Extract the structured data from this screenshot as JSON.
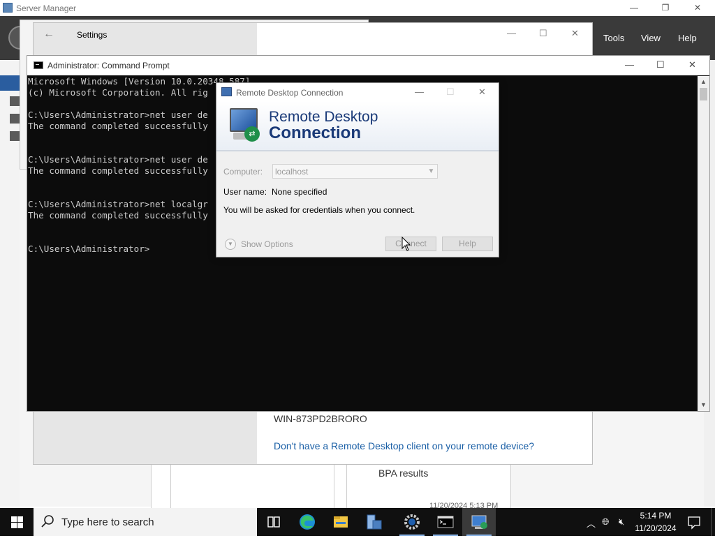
{
  "server_manager": {
    "title": "Server Manager",
    "window_controls": [
      "—",
      "❐",
      "✕"
    ],
    "menu": [
      "Tools",
      "View",
      "Help"
    ],
    "computer_name": "WIN-873PD2BRORO",
    "rd_client_link": "Don't have a Remote Desktop client on your remote device?",
    "bpa_results": "BPA results",
    "panel_timestamp": "11/20/2024 5:13 PM"
  },
  "settings": {
    "title": "Settings",
    "back": "←",
    "window_controls": [
      "—",
      "☐",
      "✕"
    ]
  },
  "cmd": {
    "title": "Administrator: Command Prompt",
    "window_controls": [
      "—",
      "☐",
      "✕"
    ],
    "lines": [
      "Microsoft Windows [Version 10.0.20348.587]",
      "(c) Microsoft Corporation. All rig",
      "",
      "C:\\Users\\Administrator>net user de",
      "The command completed successfully",
      "",
      "",
      "C:\\Users\\Administrator>net user de",
      "The command completed successfully",
      "",
      "",
      "C:\\Users\\Administrator>net localgr",
      "The command completed successfully",
      "",
      "",
      "C:\\Users\\Administrator>"
    ]
  },
  "rdc": {
    "title": "Remote Desktop Connection",
    "window_controls": [
      "—",
      "☐",
      "✕"
    ],
    "banner_line1": "Remote Desktop",
    "banner_line2": "Connection",
    "computer_label": "Computer:",
    "computer_value": "localhost",
    "user_label": "User name:",
    "user_value": "None specified",
    "info": "You will be asked for credentials when you connect.",
    "show_options": "Show Options",
    "connect": "Connect",
    "help": "Help"
  },
  "taskbar": {
    "search_placeholder": "Type here to search",
    "time": "5:14 PM",
    "date": "11/20/2024",
    "apps": [
      "task-view-icon",
      "edge-icon",
      "file-explorer-icon",
      "server-manager-icon",
      "settings-icon",
      "cmd-icon",
      "remote-desktop-icon"
    ],
    "accent": "#8bb4e6"
  }
}
